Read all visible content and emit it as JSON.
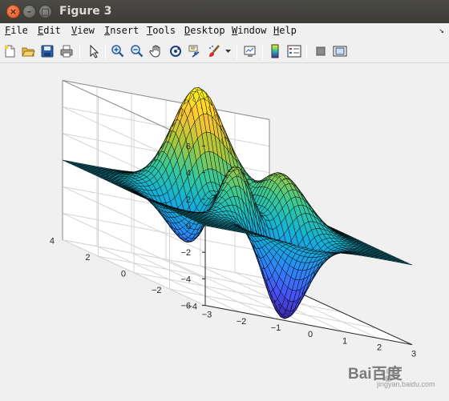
{
  "window": {
    "title": "Figure 3",
    "close_glyph": "×",
    "minimize_glyph": "–",
    "maximize_glyph": "□"
  },
  "menu": {
    "items": [
      {
        "label_u": "F",
        "label_rest": "ile"
      },
      {
        "label_u": "E",
        "label_rest": "dit"
      },
      {
        "label_u": "V",
        "label_rest": "iew"
      },
      {
        "label_u": "I",
        "label_rest": "nsert"
      },
      {
        "label_u": "T",
        "label_rest": "ools"
      },
      {
        "label_u": "D",
        "label_rest": "esktop"
      },
      {
        "label_u": "W",
        "label_rest": "indow"
      },
      {
        "label_u": "H",
        "label_rest": "elp"
      }
    ],
    "dock_glyph": "↘"
  },
  "toolbar": {
    "icons": [
      "new-figure-icon",
      "open-file-icon",
      "save-icon",
      "print-icon",
      "edit-plot-arrow-icon",
      "zoom-in-icon",
      "zoom-out-icon",
      "pan-hand-icon",
      "rotate-3d-icon",
      "data-cursor-icon",
      "brush-icon",
      "brush-dropdown-icon",
      "link-plot-icon",
      "insert-colorbar-icon",
      "insert-legend-icon",
      "hide-plot-tools-icon",
      "show-plot-tools-icon"
    ]
  },
  "axes": {
    "z_ticks": [
      "6",
      "4",
      "2",
      "0",
      "−2",
      "−4",
      "−6"
    ],
    "y_ticks": [
      "4",
      "2",
      "0",
      "−2",
      "−4"
    ],
    "x_ticks": [
      "−3",
      "−2",
      "−1",
      "0",
      "1",
      "2",
      "3"
    ]
  },
  "plot": {
    "function": "peaks",
    "colormap": "parula",
    "grid": "on",
    "x_range": [
      -3,
      3
    ],
    "y_range": [
      -4,
      4
    ],
    "z_range": [
      -6,
      6
    ]
  },
  "watermark": {
    "text": "Bai百度",
    "sub": "jingyan.baidu.com"
  }
}
